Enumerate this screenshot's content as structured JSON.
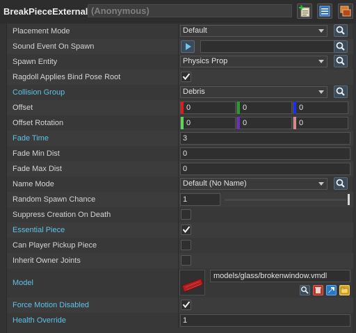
{
  "header": {
    "class_name": "BreakPieceExternal",
    "entity_name": "(Anonymous)",
    "buttons": [
      "add-note-icon",
      "list-icon",
      "windows-icon"
    ]
  },
  "properties": [
    {
      "label": "Placement Mode",
      "type": "dropdown",
      "value": "Default",
      "picker": true
    },
    {
      "label": "Sound Event On Spawn",
      "type": "sound",
      "value": "",
      "picker": true
    },
    {
      "label": "Spawn Entity",
      "type": "dropdown",
      "value": "Physics Prop",
      "picker": true
    },
    {
      "label": "Ragdoll Applies Bind Pose Root",
      "type": "checkbox",
      "checked": true
    },
    {
      "label": "Collision Group",
      "type": "dropdown",
      "value": "Debris",
      "picker": true,
      "highlight": true
    },
    {
      "label": "Offset",
      "type": "vector",
      "values": [
        "0",
        "0",
        "0"
      ],
      "colors": [
        "#d81e1e",
        "#2a9a2a",
        "#1e2ee0"
      ]
    },
    {
      "label": "Offset Rotation",
      "type": "vector",
      "values": [
        "0",
        "0",
        "0"
      ],
      "colors": [
        "#5ed35e",
        "#6a2fbd",
        "#d48a8a"
      ]
    },
    {
      "label": "Fade Time",
      "type": "text",
      "value": "3",
      "highlight": true
    },
    {
      "label": "Fade Min Dist",
      "type": "text",
      "value": "0"
    },
    {
      "label": "Fade Max Dist",
      "type": "text",
      "value": "0"
    },
    {
      "label": "Name Mode",
      "type": "dropdown",
      "value": "Default (No Name)",
      "picker": true
    },
    {
      "label": "Random Spawn Chance",
      "type": "slider",
      "value": "1",
      "level": 1.0
    },
    {
      "label": "Suppress Creation On Death",
      "type": "checkbox",
      "checked": false
    },
    {
      "label": "Essential Piece",
      "type": "checkbox",
      "checked": true,
      "highlight": true
    },
    {
      "label": "Can Player Pickup Piece",
      "type": "checkbox",
      "checked": false
    },
    {
      "label": "Inherit Owner Joints",
      "type": "checkbox",
      "checked": false
    },
    {
      "label": "Model",
      "type": "model",
      "value": "models/glass/brokenwindow.vmdl",
      "highlight": true,
      "buttons": [
        "search-icon",
        "remove-icon",
        "open-in-editor-icon",
        "folder-icon"
      ]
    },
    {
      "label": "Force Motion Disabled",
      "type": "checkbox",
      "checked": true,
      "highlight": true
    },
    {
      "label": "Health Override",
      "type": "text",
      "value": "1",
      "highlight": true
    }
  ],
  "colors": {
    "highlight_label": "#5fc2e6",
    "background": "#333334",
    "panel": "#383839"
  }
}
